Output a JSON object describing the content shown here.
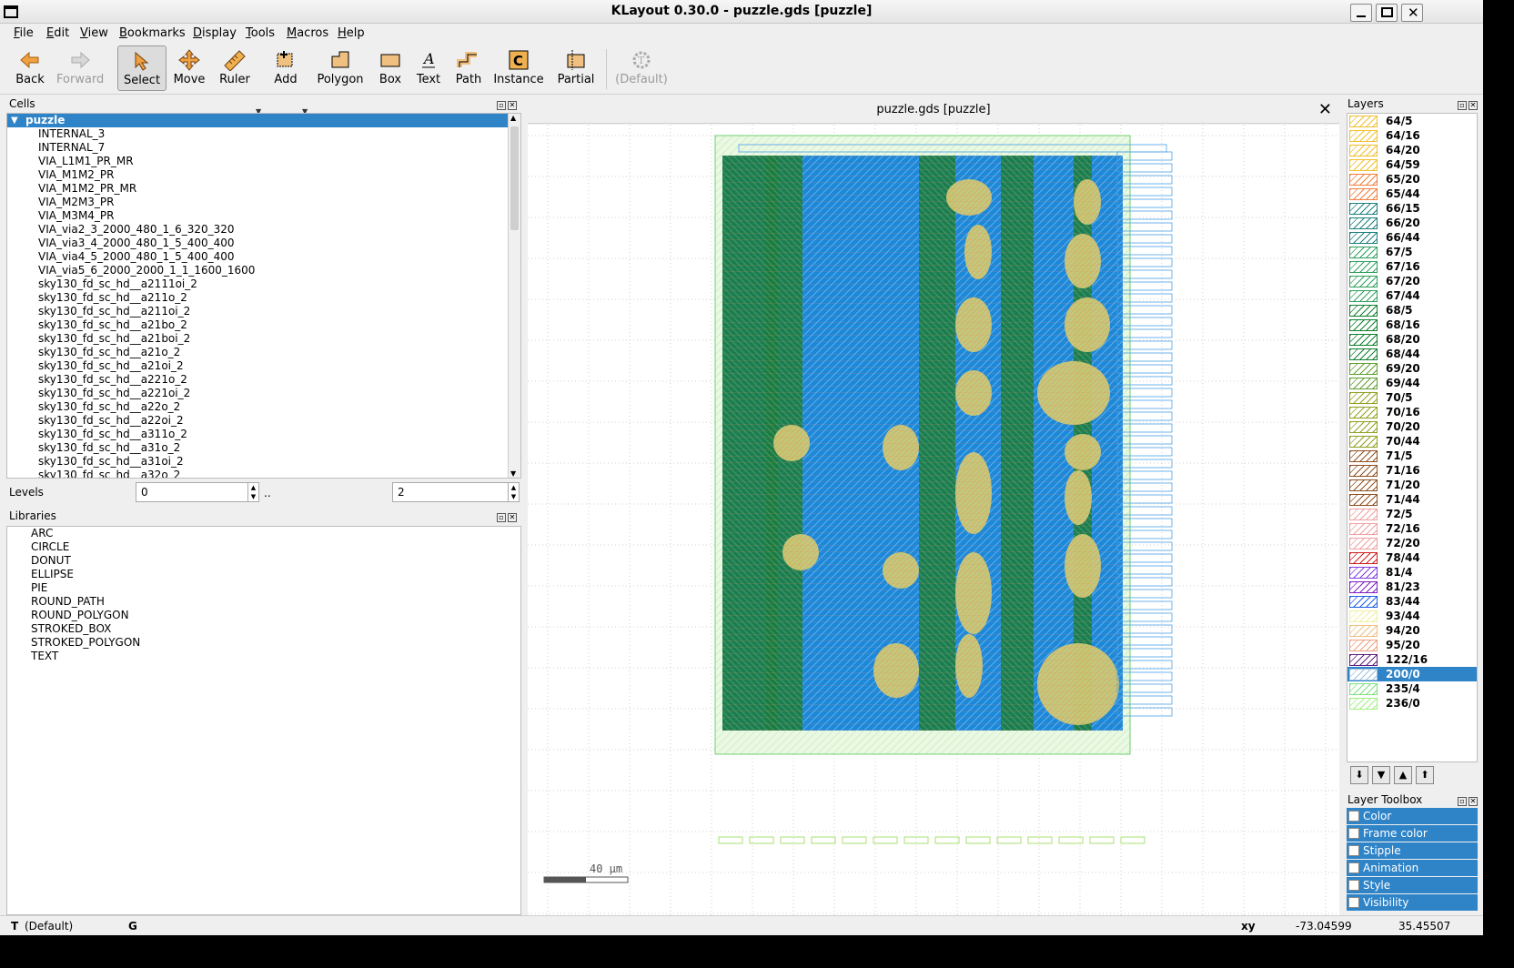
{
  "window": {
    "title": "KLayout 0.30.0 - puzzle.gds [puzzle]"
  },
  "menu": [
    "File",
    "Edit",
    "View",
    "Bookmarks",
    "Display",
    "Tools",
    "Macros",
    "Help"
  ],
  "toolbar": {
    "back": "Back",
    "forward": "Forward",
    "select": "Select",
    "move": "Move",
    "ruler": "Ruler",
    "add": "Add",
    "polygon": "Polygon",
    "box": "Box",
    "text": "Text",
    "path": "Path",
    "instance": "Instance",
    "partial": "Partial",
    "default": "(Default)"
  },
  "cells": {
    "title": "Cells",
    "root": "puzzle",
    "items": [
      "INTERNAL_3",
      "INTERNAL_7",
      "VIA_L1M1_PR_MR",
      "VIA_M1M2_PR",
      "VIA_M1M2_PR_MR",
      "VIA_M2M3_PR",
      "VIA_M3M4_PR",
      "VIA_via2_3_2000_480_1_6_320_320",
      "VIA_via3_4_2000_480_1_5_400_400",
      "VIA_via4_5_2000_480_1_5_400_400",
      "VIA_via5_6_2000_2000_1_1_1600_1600",
      "sky130_fd_sc_hd__a2111oi_2",
      "sky130_fd_sc_hd__a211o_2",
      "sky130_fd_sc_hd__a211oi_2",
      "sky130_fd_sc_hd__a21bo_2",
      "sky130_fd_sc_hd__a21boi_2",
      "sky130_fd_sc_hd__a21o_2",
      "sky130_fd_sc_hd__a21oi_2",
      "sky130_fd_sc_hd__a221o_2",
      "sky130_fd_sc_hd__a221oi_2",
      "sky130_fd_sc_hd__a22o_2",
      "sky130_fd_sc_hd__a22oi_2",
      "sky130_fd_sc_hd__a311o_2",
      "sky130_fd_sc_hd__a31o_2",
      "sky130_fd_sc_hd__a31oi_2",
      "sky130_fd_sc_hd__a32o_2"
    ]
  },
  "levels": {
    "label": "Levels",
    "from": "0",
    "sep": "..",
    "to": "2"
  },
  "libraries": {
    "title": "Libraries",
    "items": [
      "ARC",
      "CIRCLE",
      "DONUT",
      "ELLIPSE",
      "PIE",
      "ROUND_PATH",
      "ROUND_POLYGON",
      "STROKED_BOX",
      "STROKED_POLYGON",
      "TEXT"
    ]
  },
  "canvas": {
    "tab_title": "puzzle.gds [puzzle]",
    "scale_label": "40 µm"
  },
  "layers": {
    "title": "Layers",
    "selected": "200/0",
    "items": [
      {
        "name": "64/5",
        "color": "#f0c030"
      },
      {
        "name": "64/16",
        "color": "#f0c030"
      },
      {
        "name": "64/20",
        "color": "#f0c030"
      },
      {
        "name": "64/59",
        "color": "#f0c030"
      },
      {
        "name": "65/20",
        "color": "#f08040"
      },
      {
        "name": "65/44",
        "color": "#f08040"
      },
      {
        "name": "66/15",
        "color": "#208080"
      },
      {
        "name": "66/20",
        "color": "#208080"
      },
      {
        "name": "66/44",
        "color": "#208080"
      },
      {
        "name": "67/5",
        "color": "#30a060"
      },
      {
        "name": "67/16",
        "color": "#30a060"
      },
      {
        "name": "67/20",
        "color": "#30a060"
      },
      {
        "name": "67/44",
        "color": "#30a060"
      },
      {
        "name": "68/5",
        "color": "#108030"
      },
      {
        "name": "68/16",
        "color": "#108030"
      },
      {
        "name": "68/20",
        "color": "#108030"
      },
      {
        "name": "68/44",
        "color": "#108030"
      },
      {
        "name": "69/20",
        "color": "#60a030"
      },
      {
        "name": "69/44",
        "color": "#60a030"
      },
      {
        "name": "70/5",
        "color": "#90a020"
      },
      {
        "name": "70/16",
        "color": "#90a020"
      },
      {
        "name": "70/20",
        "color": "#90a020"
      },
      {
        "name": "70/44",
        "color": "#90a020"
      },
      {
        "name": "71/5",
        "color": "#905020"
      },
      {
        "name": "71/16",
        "color": "#905020"
      },
      {
        "name": "71/20",
        "color": "#905020"
      },
      {
        "name": "71/44",
        "color": "#905020"
      },
      {
        "name": "72/5",
        "color": "#f0a0a0"
      },
      {
        "name": "72/16",
        "color": "#f0a0a0"
      },
      {
        "name": "72/20",
        "color": "#f0a0a0"
      },
      {
        "name": "78/44",
        "color": "#d02020"
      },
      {
        "name": "81/4",
        "color": "#8040e0"
      },
      {
        "name": "81/23",
        "color": "#8020c0"
      },
      {
        "name": "83/44",
        "color": "#2060e0"
      },
      {
        "name": "93/44",
        "color": "#f0f0a0"
      },
      {
        "name": "94/20",
        "color": "#f0c080"
      },
      {
        "name": "95/20",
        "color": "#f0a080"
      },
      {
        "name": "122/16",
        "color": "#602080"
      },
      {
        "name": "200/0",
        "color": "#a0c0e0"
      },
      {
        "name": "235/4",
        "color": "#80e080"
      },
      {
        "name": "236/0",
        "color": "#a0f080"
      }
    ]
  },
  "layer_toolbox": {
    "title": "Layer Toolbox",
    "items": [
      "Color",
      "Frame color",
      "Stipple",
      "Animation",
      "Style",
      "Visibility"
    ]
  },
  "status": {
    "mode_key": "T",
    "mode": "(Default)",
    "grid_key": "G",
    "coord_label": "xy",
    "x": "-73.04599",
    "y": "35.45507"
  }
}
